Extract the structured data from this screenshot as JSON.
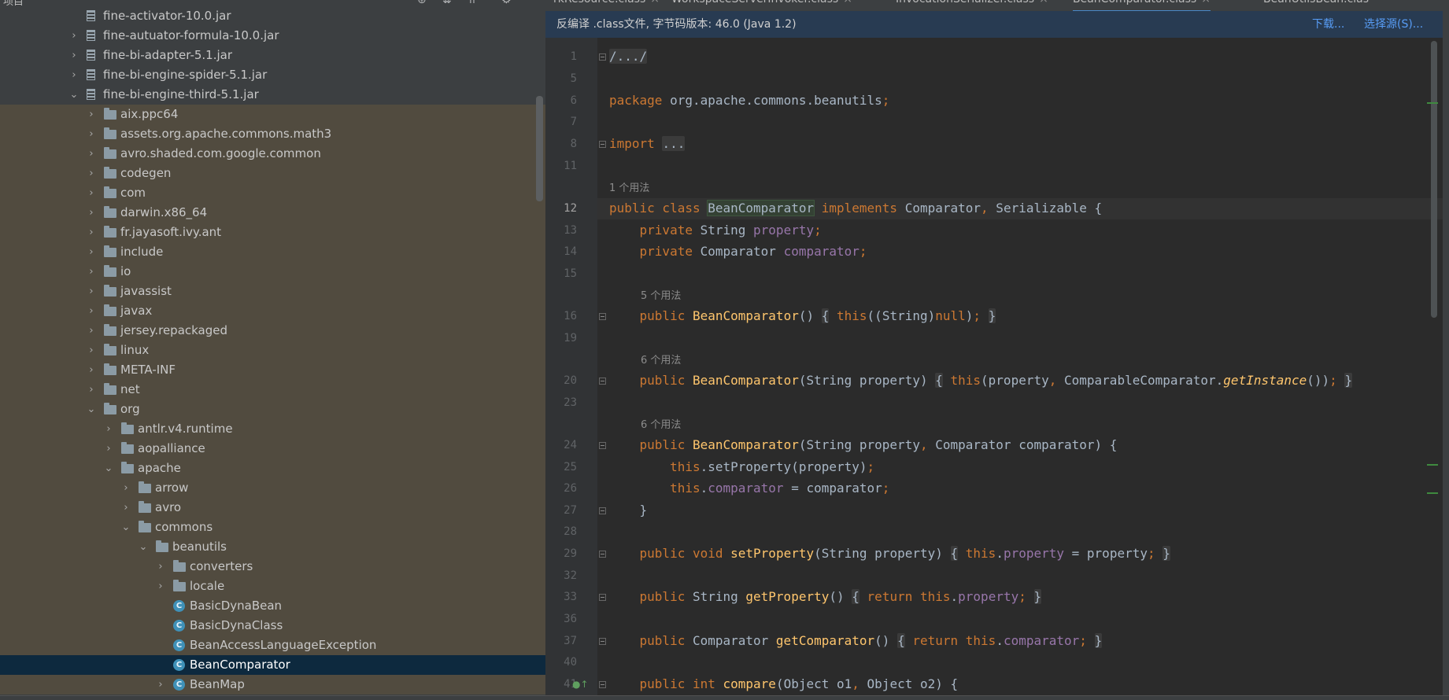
{
  "project_panel": {
    "title": "项目",
    "items": [
      {
        "depth": 0,
        "type": "jar",
        "label": "fine-activator-10.0.jar",
        "expanded": null
      },
      {
        "depth": 0,
        "type": "jar",
        "label": "fine-autuator-formula-10.0.jar",
        "expanded": false
      },
      {
        "depth": 0,
        "type": "jar",
        "label": "fine-bi-adapter-5.1.jar",
        "expanded": false
      },
      {
        "depth": 0,
        "type": "jar",
        "label": "fine-bi-engine-spider-5.1.jar",
        "expanded": false
      },
      {
        "depth": 0,
        "type": "jar",
        "label": "fine-bi-engine-third-5.1.jar",
        "expanded": true
      },
      {
        "depth": 1,
        "type": "folder",
        "label": "aix.ppc64",
        "expanded": false
      },
      {
        "depth": 1,
        "type": "folder",
        "label": "assets.org.apache.commons.math3",
        "expanded": false
      },
      {
        "depth": 1,
        "type": "folder",
        "label": "avro.shaded.com.google.common",
        "expanded": false
      },
      {
        "depth": 1,
        "type": "folder",
        "label": "codegen",
        "expanded": false
      },
      {
        "depth": 1,
        "type": "folder",
        "label": "com",
        "expanded": false
      },
      {
        "depth": 1,
        "type": "folder",
        "label": "darwin.x86_64",
        "expanded": false
      },
      {
        "depth": 1,
        "type": "folder",
        "label": "fr.jayasoft.ivy.ant",
        "expanded": false
      },
      {
        "depth": 1,
        "type": "folder",
        "label": "include",
        "expanded": false
      },
      {
        "depth": 1,
        "type": "folder",
        "label": "io",
        "expanded": false
      },
      {
        "depth": 1,
        "type": "folder",
        "label": "javassist",
        "expanded": false
      },
      {
        "depth": 1,
        "type": "folder",
        "label": "javax",
        "expanded": false
      },
      {
        "depth": 1,
        "type": "folder",
        "label": "jersey.repackaged",
        "expanded": false
      },
      {
        "depth": 1,
        "type": "folder",
        "label": "linux",
        "expanded": false
      },
      {
        "depth": 1,
        "type": "folder",
        "label": "META-INF",
        "expanded": false
      },
      {
        "depth": 1,
        "type": "folder",
        "label": "net",
        "expanded": false
      },
      {
        "depth": 1,
        "type": "folder",
        "label": "org",
        "expanded": true
      },
      {
        "depth": 2,
        "type": "folder",
        "label": "antlr.v4.runtime",
        "expanded": false
      },
      {
        "depth": 2,
        "type": "folder",
        "label": "aopalliance",
        "expanded": false
      },
      {
        "depth": 2,
        "type": "folder",
        "label": "apache",
        "expanded": true
      },
      {
        "depth": 3,
        "type": "folder",
        "label": "arrow",
        "expanded": false
      },
      {
        "depth": 3,
        "type": "folder",
        "label": "avro",
        "expanded": false
      },
      {
        "depth": 3,
        "type": "folder",
        "label": "commons",
        "expanded": true
      },
      {
        "depth": 4,
        "type": "folder",
        "label": "beanutils",
        "expanded": true
      },
      {
        "depth": 5,
        "type": "folder",
        "label": "converters",
        "expanded": false
      },
      {
        "depth": 5,
        "type": "folder",
        "label": "locale",
        "expanded": false
      },
      {
        "depth": 5,
        "type": "class",
        "label": "BasicDynaBean",
        "expanded": null
      },
      {
        "depth": 5,
        "type": "class",
        "label": "BasicDynaClass",
        "expanded": null
      },
      {
        "depth": 5,
        "type": "class",
        "label": "BeanAccessLanguageException",
        "expanded": null
      },
      {
        "depth": 5,
        "type": "class",
        "label": "BeanComparator",
        "expanded": null,
        "selected": true
      },
      {
        "depth": 5,
        "type": "class",
        "label": "BeanMap",
        "expanded": false
      }
    ]
  },
  "tabs": [
    {
      "label": "rkResource.class",
      "active": false
    },
    {
      "label": "WorkspaceServerInvoker.class",
      "active": false
    },
    {
      "label": "InvocationSerializer.class",
      "active": false
    },
    {
      "label": "BeanComparator.class",
      "active": true
    },
    {
      "label": "BeanUtilsBean.clas",
      "active": false
    }
  ],
  "decompile_notice": {
    "message": "反编译 .class文件, 字节码版本: 46.0 (Java 1.2)",
    "download_link": "下载...",
    "choose_source_link": "选择源(S)..."
  },
  "editor": {
    "current_line": "12",
    "lines": [
      {
        "num": "1",
        "fold": true,
        "html": "<span class='fb'>/.../</span>"
      },
      {
        "num": "5",
        "html": ""
      },
      {
        "num": "6",
        "html": "<span class='kw'>package</span> org.apache.commons.beanutils<span class='kw'>;</span>"
      },
      {
        "num": "7",
        "html": ""
      },
      {
        "num": "8",
        "fold": true,
        "html": "<span class='kw'>import</span> <span class='fb'>...</span>"
      },
      {
        "num": "11",
        "html": "",
        "hint": "1 个用法"
      },
      {
        "num": "12",
        "current": true,
        "html": "<span class='kw'>public class</span> <span class='cls-hl'>BeanComparator</span> <span class='kw'>implements</span> Comparator<span class='kw'>,</span> Serializable {"
      },
      {
        "num": "13",
        "html": "    <span class='kw'>private</span> String <span class='fld'>property</span><span class='kw'>;</span>"
      },
      {
        "num": "14",
        "html": "    <span class='kw'>private</span> Comparator <span class='fld'>comparator</span><span class='kw'>;</span>"
      },
      {
        "num": "15",
        "html": "",
        "hint": "5 个用法"
      },
      {
        "num": "16",
        "fold": true,
        "html": "    <span class='kw'>public</span> <span class='fn'>BeanComparator</span>() <span class='fb'>{</span> <span class='kw'>this</span>((String)<span class='kw'>null</span>)<span class='kw'>;</span> <span class='fb'>}</span>"
      },
      {
        "num": "19",
        "html": "",
        "hint": "6 个用法"
      },
      {
        "num": "20",
        "fold": true,
        "html": "    <span class='kw'>public</span> <span class='fn'>BeanComparator</span>(String property) <span class='fb'>{</span> <span class='kw'>this</span>(property<span class='kw'>,</span> ComparableComparator.<span class='fn it'>getInstance</span>())<span class='kw'>;</span> <span class='fb'>}</span>"
      },
      {
        "num": "23",
        "html": "",
        "hint": "6 个用法"
      },
      {
        "num": "24",
        "fold": true,
        "html": "    <span class='kw'>public</span> <span class='fn'>BeanComparator</span>(String property<span class='kw'>,</span> Comparator comparator) {"
      },
      {
        "num": "25",
        "html": "        <span class='kw'>this</span>.setProperty(property)<span class='kw'>;</span>"
      },
      {
        "num": "26",
        "html": "        <span class='kw'>this</span>.<span class='fld'>comparator</span> = comparator<span class='kw'>;</span>"
      },
      {
        "num": "27",
        "fold": true,
        "html": "    }"
      },
      {
        "num": "28",
        "html": ""
      },
      {
        "num": "29",
        "fold": true,
        "html": "    <span class='kw'>public void</span> <span class='fn'>setProperty</span>(String property) <span class='fb'>{</span> <span class='kw'>this</span>.<span class='fld'>property</span> = property<span class='kw'>;</span> <span class='fb'>}</span>"
      },
      {
        "num": "32",
        "html": ""
      },
      {
        "num": "33",
        "fold": true,
        "html": "    <span class='kw'>public</span> String <span class='fn'>getProperty</span>() <span class='fb'>{</span> <span class='kw'>return this</span>.<span class='fld'>property</span><span class='kw'>;</span> <span class='fb'>}</span>"
      },
      {
        "num": "36",
        "html": ""
      },
      {
        "num": "37",
        "fold": true,
        "html": "    <span class='kw'>public</span> Comparator <span class='fn'>getComparator</span>() <span class='fb'>{</span> <span class='kw'>return this</span>.<span class='fld'>comparator</span><span class='kw'>;</span> <span class='fb'>}</span>"
      },
      {
        "num": "40",
        "html": ""
      },
      {
        "num": "41",
        "fold": true,
        "override": true,
        "html": "    <span class='kw'>public int</span> <span class='fn'>compare</span>(Object o1<span class='kw'>,</span> Object o2) {"
      }
    ]
  },
  "colors": {
    "accent": "#4a88c7",
    "selection": "#0d293e",
    "highlight": "#514b3f",
    "keyword": "#cc7832",
    "method": "#ffc66d",
    "field": "#9876aa"
  }
}
